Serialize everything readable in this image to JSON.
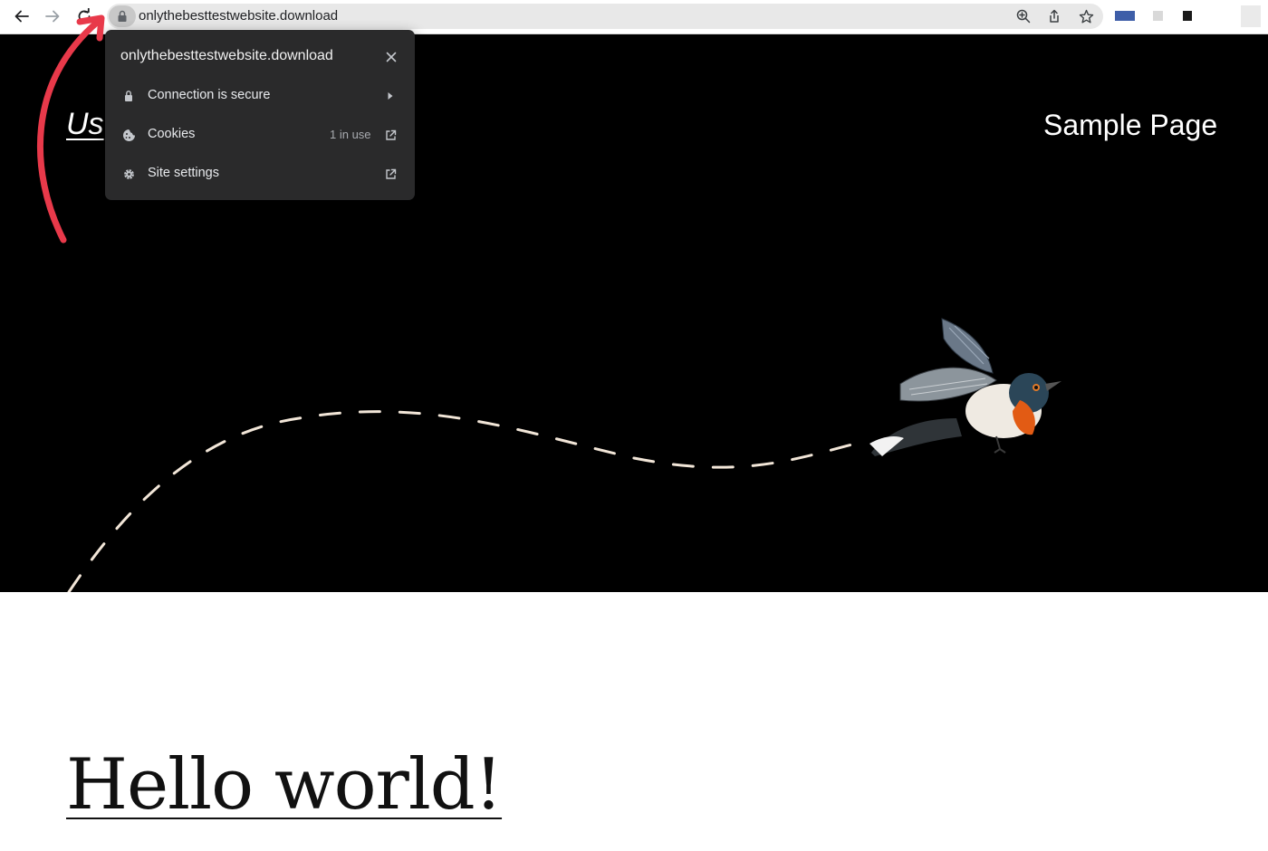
{
  "browser": {
    "url": "onlythebesttestwebsite.download",
    "icons": [
      "back-icon",
      "forward-icon",
      "reload-icon",
      "lock-icon",
      "zoom-icon",
      "share-icon",
      "bookmark-star-icon"
    ]
  },
  "site_info_popup": {
    "domain": "onlythebesttestwebsite.download",
    "rows": [
      {
        "label": "Connection is secure",
        "icon": "lock-icon",
        "trail": "chevron-right-icon"
      },
      {
        "label": "Cookies",
        "meta": "1 in use",
        "icon": "cookie-icon",
        "trail": "external-link-icon"
      },
      {
        "label": "Site settings",
        "icon": "gear-icon",
        "trail": "external-link-icon"
      }
    ]
  },
  "page": {
    "site_title": "Us",
    "nav_link": "Sample Page",
    "post_title": "Hello world!",
    "hero_background": "#000000"
  },
  "annotation": {
    "arrow_color": "#e8394a"
  }
}
